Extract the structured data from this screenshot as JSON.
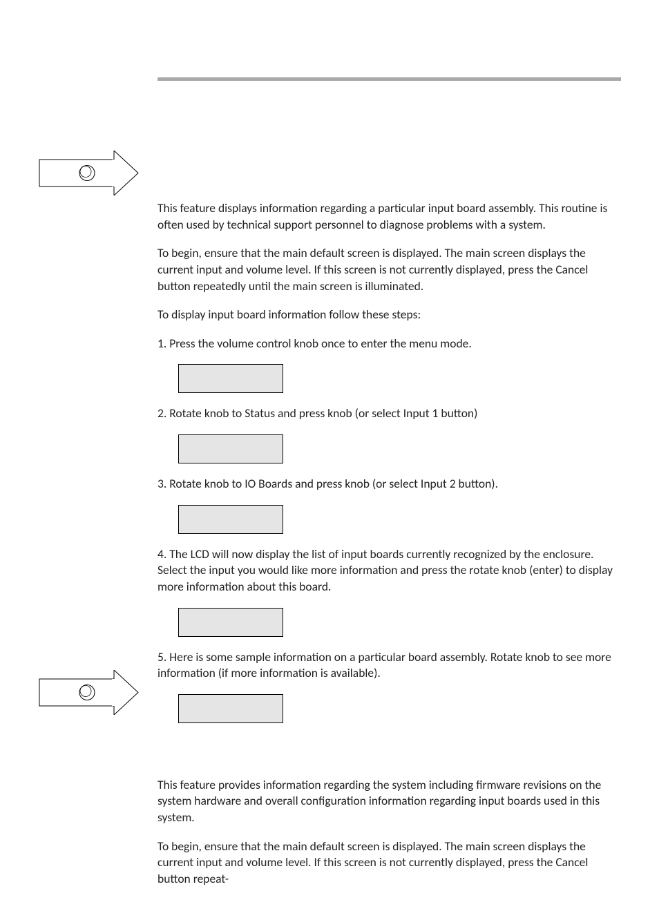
{
  "section1": {
    "p1": "This feature displays information regarding a particular input board assembly. This routine is often used by technical support personnel to diagnose problems with a system.",
    "p2": "To begin, ensure that the main default screen is displayed. The main screen displays the current input and volume level. If this screen is not currently displayed, press the Cancel button repeatedly until the main screen is illuminated.",
    "p3": "To display input board information follow these steps:",
    "step1": "1.  Press the volume control knob once to enter the menu mode.",
    "step2": "2.  Rotate knob to Status and press knob (or select Input 1 button)",
    "step3": "3.  Rotate knob to IO Boards and press knob (or select Input 2 button).",
    "step4": "4.  The LCD will now display the list of input boards currently recognized by the enclosure. Select the input you would like more information and press the rotate knob (enter) to display more information about this board.",
    "step5": "5.  Here is some sample information on a particular board assembly.  Rotate knob to see more information (if more information is available)."
  },
  "section2": {
    "p1": "This feature provides information regarding the system including firmware revisions on the system hardware and overall configuration information regarding input boards used in this system.",
    "p2": "To begin, ensure that the main default screen is displayed. The main screen displays the current input and volume level. If this screen is not currently displayed, press the Cancel button repeat-"
  }
}
